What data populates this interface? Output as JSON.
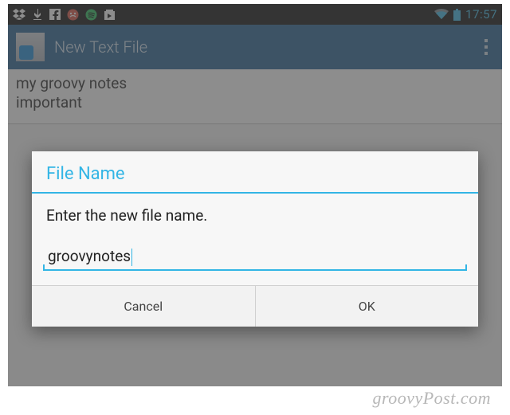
{
  "status_bar": {
    "time": "17:57"
  },
  "action_bar": {
    "title": "New Text File"
  },
  "editor": {
    "content": "my groovy notes\nimportant"
  },
  "dialog": {
    "title": "File Name",
    "message": "Enter the new file name.",
    "input_value": "groovynotes",
    "cancel_label": "Cancel",
    "ok_label": "OK"
  },
  "watermark": "groovyPost.com"
}
